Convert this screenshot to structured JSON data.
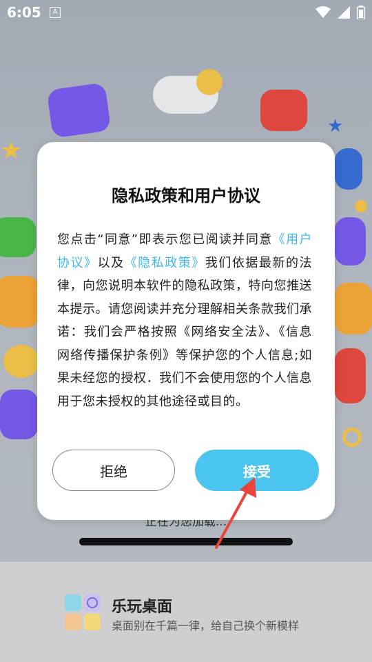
{
  "status_bar": {
    "time": "6:05",
    "notification_icon": "A"
  },
  "dialog": {
    "title": "隐私政策和用户协议",
    "body_part1": "您点击“同意”即表示您已阅读并同意",
    "link_user": "《用户协议》",
    "body_part2": "以及",
    "link_privacy": "《隐私政策》",
    "body_part3": "我们依据最新的法律，向您说明本软件的隐私政策，特向您推送本提示。请您阅读并充分理解相关条款我们承诺：我们会严格按照《网络安全法》、《信息网络传播保护条例》等保护您的个人信息;如果未经您的授权．我们不会使用您的个人信息用于您未授权的其他途径或目的。",
    "reject_label": "拒绝",
    "accept_label": "接受"
  },
  "loading": {
    "text": "正在为您加载..."
  },
  "app": {
    "title": "乐玩桌面",
    "subtitle": "桌面别在千篇一律，给自己换个新模样"
  },
  "colors": {
    "accent": "#4cc4f0",
    "link": "#3fb8f0",
    "arrow": "#e8453c"
  }
}
